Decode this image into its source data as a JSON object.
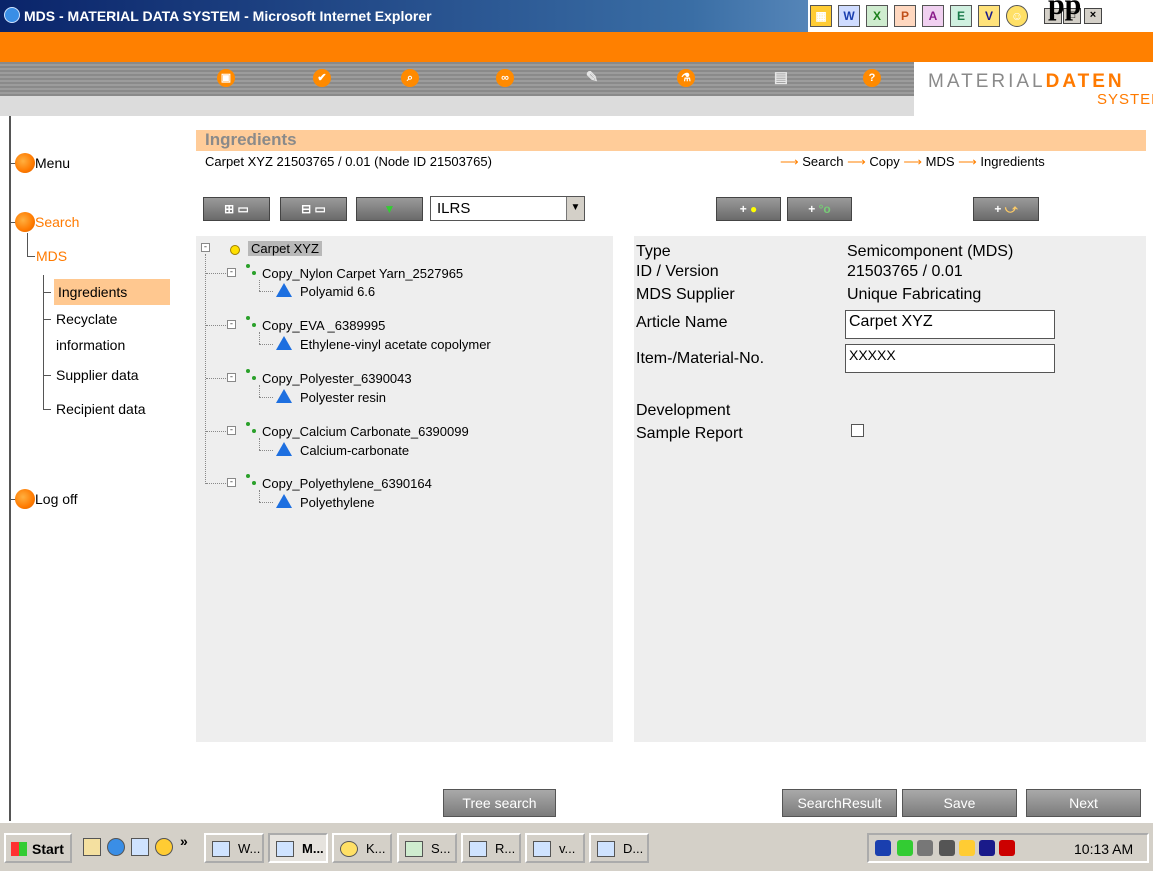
{
  "window": {
    "title": "MDS - MATERIAL DATA SYSTEM - Microsoft Internet Explorer",
    "overflow_text": "pp",
    "window_buttons": [
      "_",
      "□",
      "×"
    ]
  },
  "brand": {
    "line1_a": "MATERIAL",
    "line1_b": "DATEN",
    "line2": "SYSTEM"
  },
  "toolbar": {
    "icons": [
      "save-icon",
      "check-icon",
      "search-icon",
      "link-icon",
      "edit-icon",
      "flask-icon",
      "print-icon",
      "help-icon"
    ]
  },
  "sidebar": {
    "menu": "Menu",
    "search": "Search",
    "mds": "MDS",
    "sub_items": [
      "Ingredients",
      "Recyclate",
      "information",
      "Supplier data",
      "Recipient data"
    ],
    "logoff": "Log off"
  },
  "header": {
    "title": "Ingredients",
    "subtitle": "Carpet XYZ 21503765 / 0.01 (Node ID 21503765)",
    "path": [
      "Search",
      "Copy",
      "MDS",
      "Ingredients"
    ]
  },
  "controls": {
    "select_value": "ILRS",
    "add_buttons": [
      "+",
      "+",
      "+"
    ]
  },
  "tree": {
    "root": "Carpet XYZ",
    "children": [
      {
        "label": "Copy_Nylon Carpet Yarn_2527965",
        "material": "Polyamid 6.6"
      },
      {
        "label": "Copy_EVA _6389995",
        "material": "Ethylene-vinyl acetate copolymer"
      },
      {
        "label": "Copy_Polyester_6390043",
        "material": "Polyester resin"
      },
      {
        "label": "Copy_Calcium Carbonate_6390099",
        "material": "Calcium-carbonate"
      },
      {
        "label": "Copy_Polyethylene_6390164",
        "material": "Polyethylene"
      }
    ]
  },
  "details": {
    "type_label": "Type",
    "type_value": "Semicomponent (MDS)",
    "id_label": "ID / Version",
    "id_value": "21503765 / 0.01",
    "supplier_label": "MDS Supplier",
    "supplier_value": "Unique Fabricating",
    "article_label": "Article Name",
    "article_value": "Carpet XYZ",
    "item_label": "Item-/Material-No.",
    "item_value": "XXXXX",
    "dev_label_1": "Development",
    "dev_label_2": "Sample Report",
    "dev_checked": false
  },
  "buttons": {
    "tree_search": "Tree search",
    "search_result": "SearchResult",
    "save": "Save",
    "next": "Next"
  },
  "taskbar": {
    "start": "Start",
    "chevron": "»",
    "tasks": [
      "W...",
      "M...",
      "K...",
      "S...",
      "R...",
      "v...",
      "D..."
    ],
    "clock": "10:13 AM"
  }
}
